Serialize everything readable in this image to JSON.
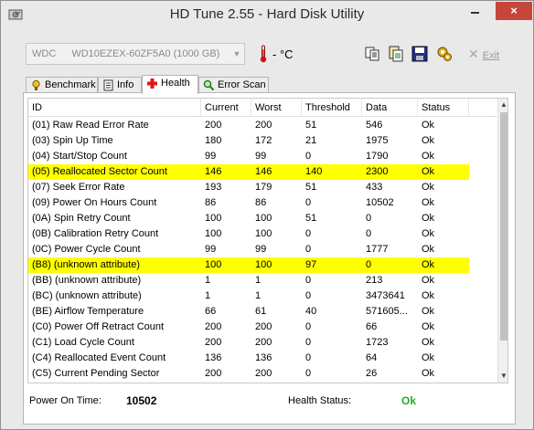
{
  "window": {
    "title": "HD Tune 2.55 - Hard Disk Utility",
    "close_glyph": "×"
  },
  "toolbar": {
    "drive_vendor": "WDC",
    "drive_model": "WD10EZEX-60ZF5A0 (1000 GB)",
    "temperature": "- °C",
    "exit_label": "Exit",
    "icons": [
      "copy-icon",
      "copy-text-icon",
      "save-icon",
      "options-icon",
      "exit-icon"
    ]
  },
  "tabs": [
    {
      "label": "Benchmark",
      "icon": "benchmark-icon"
    },
    {
      "label": "Info",
      "icon": "info-icon"
    },
    {
      "label": "Health",
      "icon": "health-cross-icon",
      "active": true
    },
    {
      "label": "Error Scan",
      "icon": "magnifier-icon"
    }
  ],
  "table": {
    "headers": [
      "ID",
      "Current",
      "Worst",
      "Threshold",
      "Data",
      "Status"
    ],
    "rows": [
      {
        "id": "(01) Raw Read Error Rate",
        "current": "200",
        "worst": "200",
        "threshold": "51",
        "data": "546",
        "status": "Ok"
      },
      {
        "id": "(03) Spin Up Time",
        "current": "180",
        "worst": "172",
        "threshold": "21",
        "data": "1975",
        "status": "Ok"
      },
      {
        "id": "(04) Start/Stop Count",
        "current": "99",
        "worst": "99",
        "threshold": "0",
        "data": "1790",
        "status": "Ok"
      },
      {
        "id": "(05) Reallocated Sector Count",
        "current": "146",
        "worst": "146",
        "threshold": "140",
        "data": "2300",
        "status": "Ok",
        "highlight": true
      },
      {
        "id": "(07) Seek Error Rate",
        "current": "193",
        "worst": "179",
        "threshold": "51",
        "data": "433",
        "status": "Ok"
      },
      {
        "id": "(09) Power On Hours Count",
        "current": "86",
        "worst": "86",
        "threshold": "0",
        "data": "10502",
        "status": "Ok"
      },
      {
        "id": "(0A) Spin Retry Count",
        "current": "100",
        "worst": "100",
        "threshold": "51",
        "data": "0",
        "status": "Ok"
      },
      {
        "id": "(0B) Calibration Retry Count",
        "current": "100",
        "worst": "100",
        "threshold": "0",
        "data": "0",
        "status": "Ok"
      },
      {
        "id": "(0C) Power Cycle Count",
        "current": "99",
        "worst": "99",
        "threshold": "0",
        "data": "1777",
        "status": "Ok"
      },
      {
        "id": "(B8) (unknown attribute)",
        "current": "100",
        "worst": "100",
        "threshold": "97",
        "data": "0",
        "status": "Ok",
        "highlight": true
      },
      {
        "id": "(BB) (unknown attribute)",
        "current": "1",
        "worst": "1",
        "threshold": "0",
        "data": "213",
        "status": "Ok"
      },
      {
        "id": "(BC) (unknown attribute)",
        "current": "1",
        "worst": "1",
        "threshold": "0",
        "data": "3473641",
        "status": "Ok"
      },
      {
        "id": "(BE) Airflow Temperature",
        "current": "66",
        "worst": "61",
        "threshold": "40",
        "data": "571605...",
        "status": "Ok"
      },
      {
        "id": "(C0) Power Off Retract Count",
        "current": "200",
        "worst": "200",
        "threshold": "0",
        "data": "66",
        "status": "Ok"
      },
      {
        "id": "(C1) Load Cycle Count",
        "current": "200",
        "worst": "200",
        "threshold": "0",
        "data": "1723",
        "status": "Ok"
      },
      {
        "id": "(C4) Reallocated Event Count",
        "current": "136",
        "worst": "136",
        "threshold": "0",
        "data": "64",
        "status": "Ok"
      },
      {
        "id": "(C5) Current Pending Sector",
        "current": "200",
        "worst": "200",
        "threshold": "0",
        "data": "26",
        "status": "Ok"
      }
    ]
  },
  "footer": {
    "power_on_label": "Power On Time:",
    "power_on_value": "10502",
    "health_label": "Health Status:",
    "health_value": "Ok"
  },
  "colors": {
    "highlight": "#ffff00",
    "ok_green": "#20b020",
    "close_red": "#c7463a"
  }
}
